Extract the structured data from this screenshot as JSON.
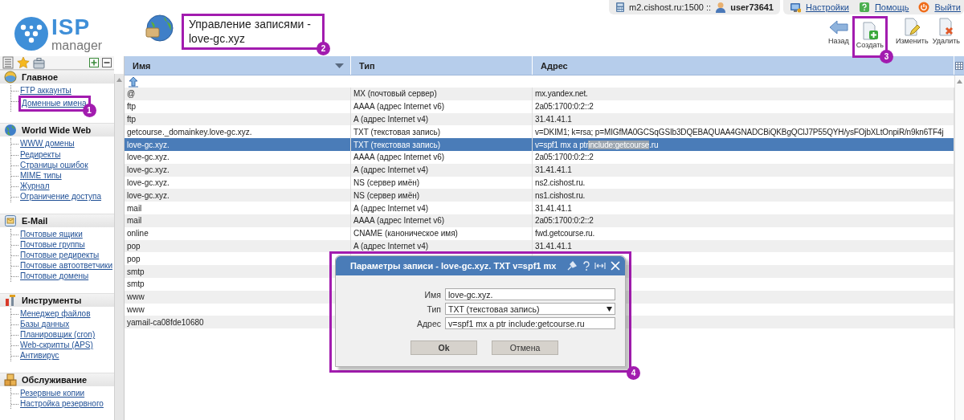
{
  "header": {
    "logo": {
      "brand": "ISP",
      "product": "manager"
    },
    "page_title": "Управление записями -\nlove-gc.xyz",
    "page_title_annotation": "2",
    "server_info": {
      "host": "m2.cishost.ru:1500 ::",
      "user": "user73641"
    },
    "top_links": [
      {
        "label": "Настройки",
        "kind": "settings"
      },
      {
        "label": "Помощь",
        "kind": "help"
      },
      {
        "label": "Выйти",
        "kind": "logout"
      }
    ],
    "toolbar": [
      {
        "label": "Назад",
        "kind": "back"
      },
      {
        "label": "Создать",
        "kind": "create",
        "annotation": "3"
      },
      {
        "label": "Изменить",
        "kind": "edit"
      },
      {
        "label": "Удалить",
        "kind": "delete"
      }
    ]
  },
  "sidebar": {
    "sections": [
      {
        "title": "Главное",
        "kind": "main",
        "items": [
          {
            "label": "FTP аккаунты"
          },
          {
            "label": "Доменные имена",
            "annotation": "1"
          }
        ]
      },
      {
        "title": "World Wide Web",
        "kind": "www",
        "items": [
          {
            "label": "WWW домены"
          },
          {
            "label": "Редиректы"
          },
          {
            "label": "Страницы ошибок"
          },
          {
            "label": "MIME типы"
          },
          {
            "label": "Журнал"
          },
          {
            "label": "Ограничение доступа"
          }
        ]
      },
      {
        "title": "E-Mail",
        "kind": "mail",
        "items": [
          {
            "label": "Почтовые ящики"
          },
          {
            "label": "Почтовые группы"
          },
          {
            "label": "Почтовые редиректы"
          },
          {
            "label": "Почтовые автоответчики"
          },
          {
            "label": "Почтовые домены"
          }
        ]
      },
      {
        "title": "Инструменты",
        "kind": "tools",
        "items": [
          {
            "label": "Менеджер файлов"
          },
          {
            "label": "Базы данных"
          },
          {
            "label": "Планировщик (cron)"
          },
          {
            "label": "Web-скрипты (APS)"
          },
          {
            "label": "Антивирус"
          }
        ]
      },
      {
        "title": "Обслуживание",
        "kind": "service",
        "items": [
          {
            "label": "Резервные копии"
          },
          {
            "label": "Настройка резервного"
          }
        ]
      }
    ]
  },
  "table": {
    "columns": [
      "Имя",
      "Тип",
      "Адрес"
    ],
    "rows": [
      {
        "name": "@",
        "type": "MX (почтовый сервер)",
        "address": "mx.yandex.net.",
        "selected": false
      },
      {
        "name": "ftp",
        "type": "AAAA (адрес Internet v6)",
        "address": "2a05:1700:0:2::2",
        "selected": false
      },
      {
        "name": "ftp",
        "type": "A (адрес Internet v4)",
        "address": "31.41.41.1",
        "selected": false
      },
      {
        "name": "getcourse._domainkey.love-gc.xyz.",
        "type": "TXT (текстовая запись)",
        "address": "v=DKIM1; k=rsa; p=MIGfMA0GCSqGSIb3DQEBAQUAA4GNADCBiQKBgQClJ7P55QYH/ysFOjbXLtOnpiR/n9kn6TF4j",
        "selected": false
      },
      {
        "name": "love-gc.xyz.",
        "type": "TXT (текстовая запись)",
        "address_segments": [
          {
            "text": "v=spf1 mx a ptr ",
            "highlighted": false
          },
          {
            "text": "include:getcourse",
            "highlighted": true
          },
          {
            "text": ".ru",
            "highlighted": false
          }
        ],
        "selected": true
      },
      {
        "name": "love-gc.xyz.",
        "type": "AAAA (адрес Internet v6)",
        "address": "2a05:1700:0:2::2",
        "selected": false
      },
      {
        "name": "love-gc.xyz.",
        "type": "A (адрес Internet v4)",
        "address": "31.41.41.1",
        "selected": false
      },
      {
        "name": "love-gc.xyz.",
        "type": "NS (сервер имён)",
        "address": "ns2.cishost.ru.",
        "selected": false
      },
      {
        "name": "love-gc.xyz.",
        "type": "NS (сервер имён)",
        "address": "ns1.cishost.ru.",
        "selected": false
      },
      {
        "name": "mail",
        "type": "A (адрес Internet v4)",
        "address": "31.41.41.1",
        "selected": false
      },
      {
        "name": "mail",
        "type": "AAAA (адрес Internet v6)",
        "address": "2a05:1700:0:2::2",
        "selected": false
      },
      {
        "name": "online",
        "type": "CNAME (каноническое имя)",
        "address": "fwd.getcourse.ru.",
        "selected": false
      },
      {
        "name": "pop",
        "type": "A (адрес Internet v4)",
        "address": "31.41.41.1",
        "selected": false
      },
      {
        "name": "pop",
        "selected": false
      },
      {
        "name": "smtp",
        "selected": false
      },
      {
        "name": "smtp",
        "selected": false
      },
      {
        "name": "www",
        "selected": false
      },
      {
        "name": "www",
        "selected": false
      },
      {
        "name": "yamail-ca08fde10680",
        "selected": false
      }
    ]
  },
  "dialog": {
    "title": "Параметры записи - love-gc.xyz. TXT v=spf1 mx",
    "annotation": "4",
    "fields": [
      {
        "label": "Имя",
        "kind": "text",
        "value": "love-gc.xyz."
      },
      {
        "label": "Тип",
        "kind": "select",
        "value": "TXT (текстовая запись)"
      },
      {
        "label": "Адрес",
        "kind": "text",
        "value": "v=spf1 mx a ptr include:getcourse.ru"
      }
    ],
    "buttons": [
      "Ok",
      "Отмена"
    ]
  }
}
